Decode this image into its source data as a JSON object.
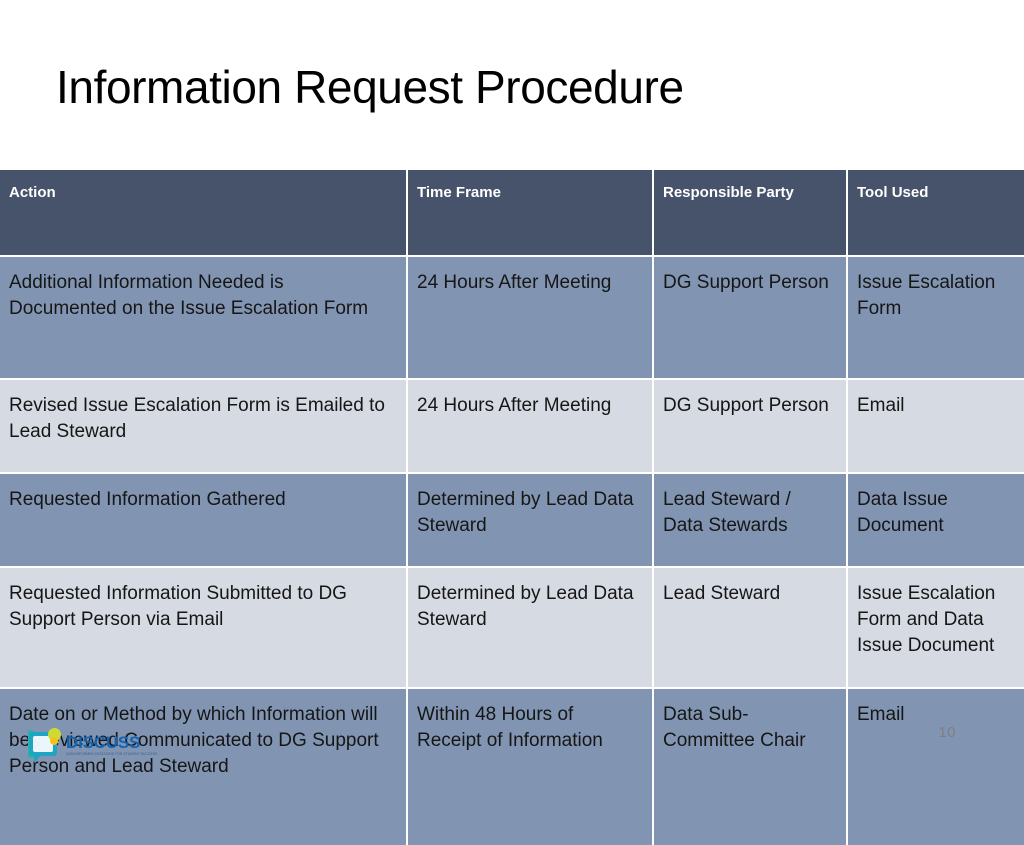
{
  "slide": {
    "title": "Information Request Procedure",
    "page_number": "10",
    "background_color": "#ffffff"
  },
  "colors": {
    "header_bg": "#47536b",
    "row_dark_bg": "#8195b3",
    "row_light_bg": "#d6dae3",
    "header_text": "#ffffff",
    "body_text": "#161616",
    "page_number_text": "#7f7f7f",
    "logo_blue": "#1464b4"
  },
  "table": {
    "headers": [
      "Action",
      "Time Frame",
      "Responsible Party",
      "Tool Used"
    ],
    "rows": [
      {
        "action": "Additional Information Needed is Documented on the Issue Escalation Form",
        "time_frame": "24 Hours After Meeting",
        "responsible_party": "DG Support Person",
        "tool_used": "Issue Escalation Form"
      },
      {
        "action": "Revised Issue Escalation Form is Emailed to Lead Steward",
        "time_frame": "24 Hours After Meeting",
        "responsible_party": "DG Support Person",
        "tool_used": "Email"
      },
      {
        "action": "Requested Information Gathered",
        "time_frame": "Determined by Lead Data Steward",
        "responsible_party": "Lead Steward / Data Stewards",
        "tool_used": "Data Issue Document"
      },
      {
        "action": "Requested Information Submitted to DG Support Person via Email",
        "time_frame": "Determined by Lead Data Steward",
        "responsible_party": "Lead Steward",
        "tool_used": "Issue Escalation Form and Data Issue Document"
      },
      {
        "action": "Date on or Method by which Information will be Reviewed Communicated to DG Support Person and Lead Steward",
        "time_frame": "Within 48 Hours of Receipt of Information",
        "responsible_party": "Data Sub-Committee Chair",
        "tool_used": "Email"
      }
    ]
  },
  "logo": {
    "word": "DISCUSS",
    "tagline": "DATA INFORMED DECISIONS FOR STUDENT SUCCESS"
  }
}
